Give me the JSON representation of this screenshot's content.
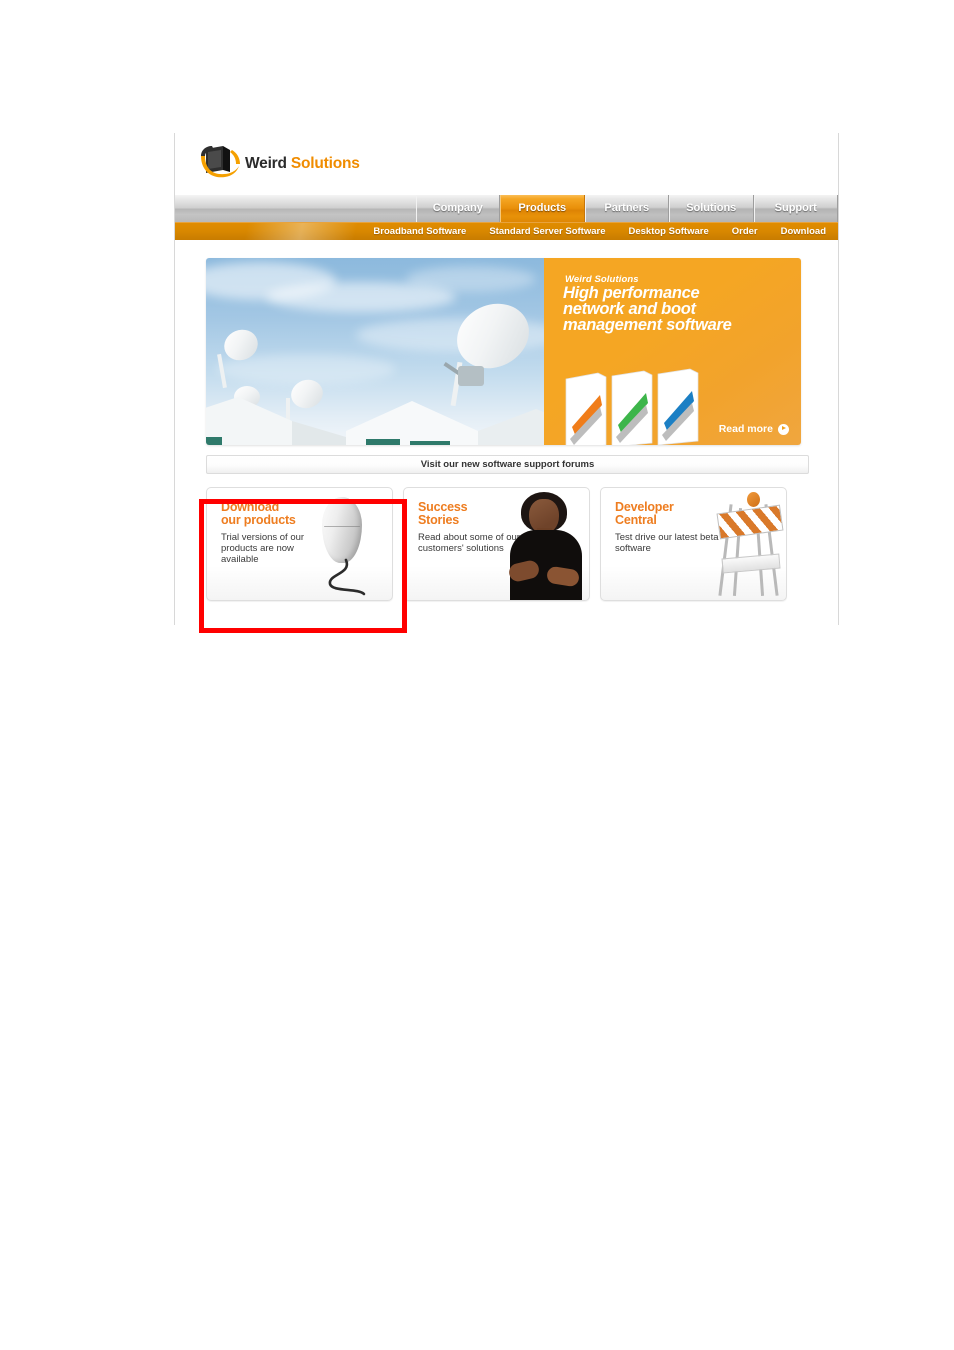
{
  "site": {
    "brand": {
      "logo_icon": "monitor-swoosh-logo-icon",
      "name_part1": "Weird",
      "name_part2": "Solutions",
      "color_dark": "#2b2b2b",
      "color_accent": "#f08c00"
    },
    "nav": {
      "tabs": [
        {
          "label": "Company",
          "active": false
        },
        {
          "label": "Products",
          "active": true
        },
        {
          "label": "Partners",
          "active": false
        },
        {
          "label": "Solutions",
          "active": false
        },
        {
          "label": "Support",
          "active": false
        }
      ],
      "active_color": "#e98f09",
      "inactive_color": "#c0c0c0"
    },
    "subnav": {
      "items": [
        {
          "label": "Broadband Software"
        },
        {
          "label": "Standard Server Software"
        },
        {
          "label": "Desktop Software"
        },
        {
          "label": "Order"
        },
        {
          "label": "Download"
        }
      ],
      "background_color": "#d98800"
    },
    "hero": {
      "photo_alt": "satellite-dishes-photo",
      "eyebrow": "Weird Solutions",
      "headline_line1": "High performance",
      "headline_line2": "network and boot",
      "headline_line3": "management software",
      "product_boxes_alt": "three-software-boxes",
      "read_more_label": "Read more",
      "read_more_icon": "play-circle-icon",
      "panel_color": "#f5a623"
    },
    "forum_bar": {
      "label": "Visit our new software support forums"
    },
    "cards": [
      {
        "title_line1": "Download",
        "title_line2": "our products",
        "body": "Trial versions of our products are now available",
        "art": "computer-mouse-image",
        "highlighted": true
      },
      {
        "title_line1": "Success",
        "title_line2": "Stories",
        "body": "Read about some of our customers' solutions",
        "art": "smiling-woman-photo",
        "highlighted": false
      },
      {
        "title_line1": "Developer",
        "title_line2": "Central",
        "body": "Test drive our latest beta software",
        "art": "construction-barricade-image",
        "highlighted": false
      }
    ],
    "card_title_color": "#ee7d20",
    "highlight": {
      "color": "#ff0000",
      "target": "download-our-products-card"
    }
  }
}
